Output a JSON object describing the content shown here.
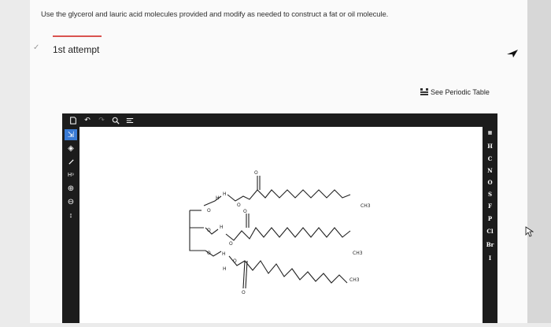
{
  "question": "Use the glycerol and lauric acid molecules provided and modify as needed to construct a fat or oil molecule.",
  "attempt": {
    "label": "1st attempt"
  },
  "periodic_table": {
    "label": "See Periodic Table"
  },
  "elements": [
    "H",
    "C",
    "N",
    "O",
    "S",
    "F",
    "P",
    "Cl",
    "Br",
    "I"
  ],
  "molecule_labels": {
    "ch3_1": "CH3",
    "ch3_2": "CH3",
    "ch3_3": "CH3",
    "o": "O",
    "h": "H"
  },
  "colors": {
    "accent": "#d9534f",
    "toolbar": "#1c1c1c"
  }
}
